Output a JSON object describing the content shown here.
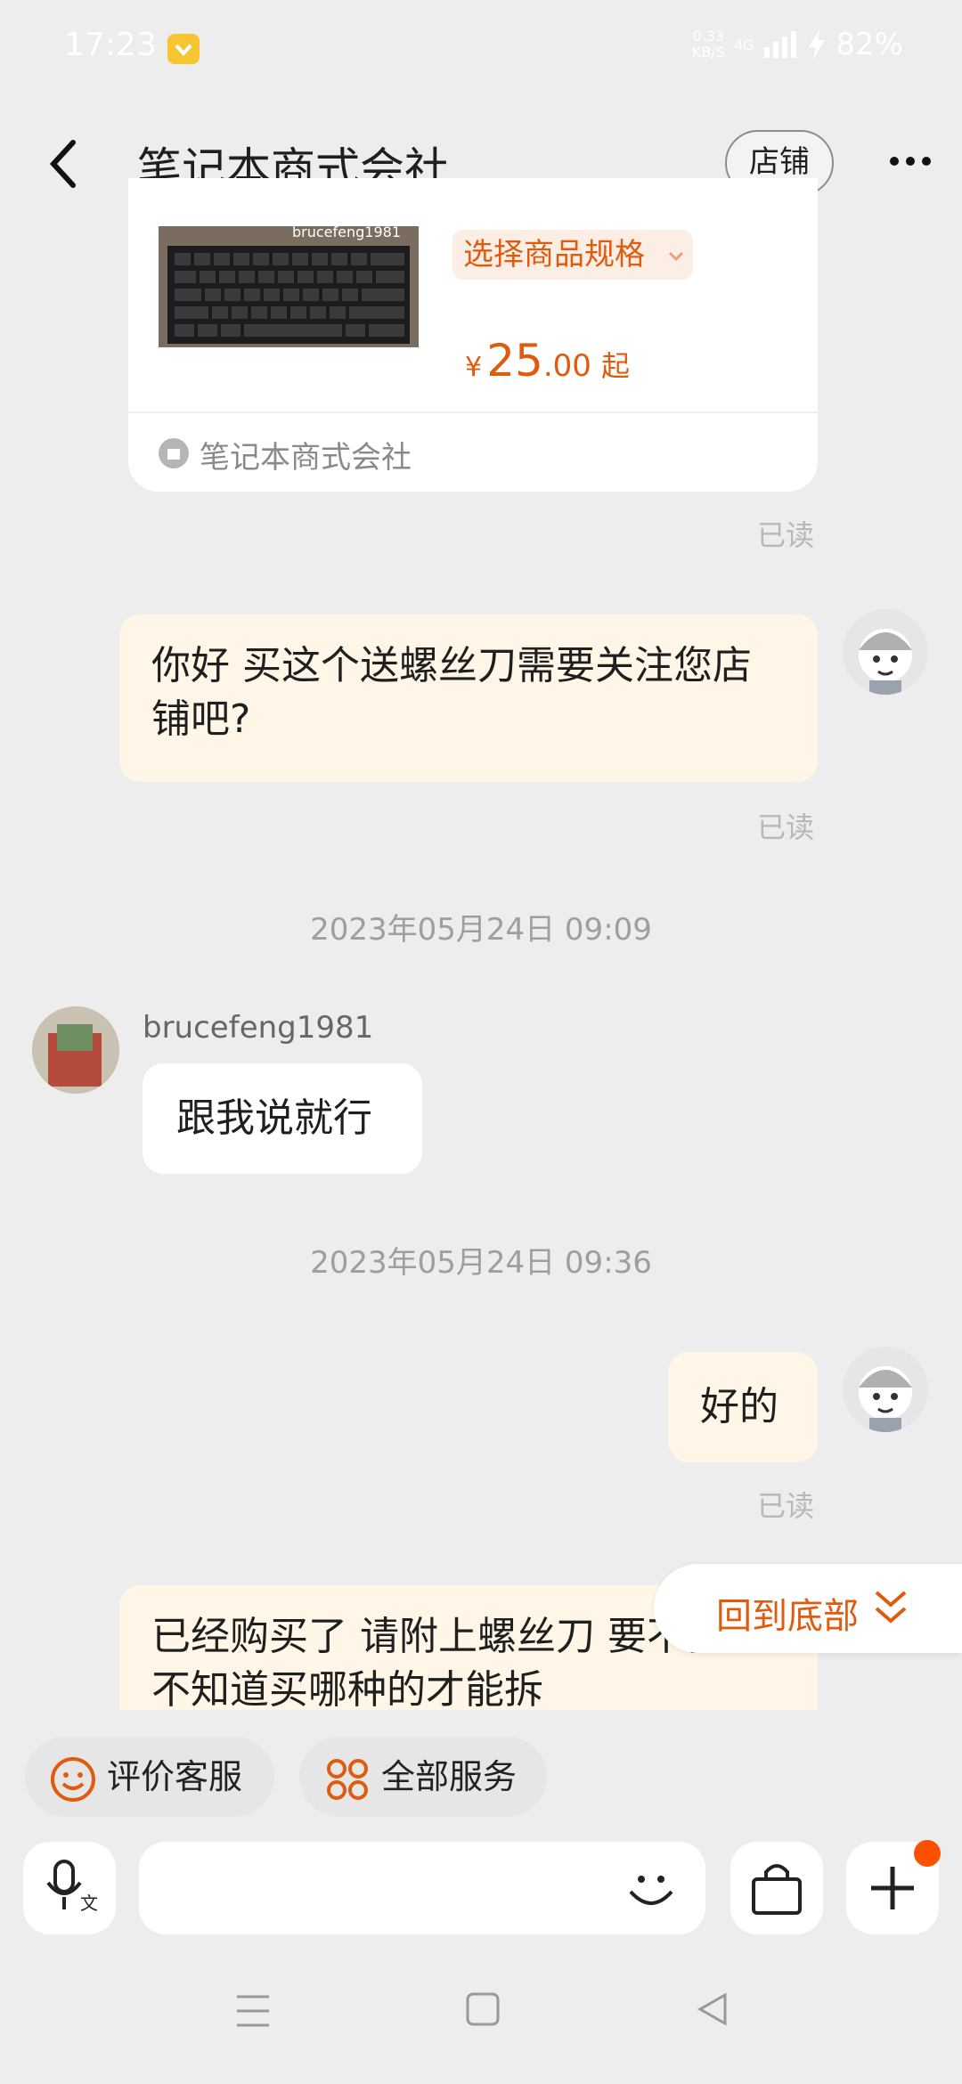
{
  "status_bar": {
    "time": "17:23",
    "speed_value": "0.33",
    "speed_unit": "KB/S",
    "network": "4G",
    "battery": "82%"
  },
  "header": {
    "title": "笔记本商式会社",
    "shop_button": "店铺"
  },
  "product_card": {
    "image_watermark": "brucefeng1981",
    "spec_button": "选择商品规格",
    "price_symbol": "¥",
    "price_int": "25",
    "price_dec": ".00",
    "price_suffix": "起",
    "shop_name": "笔记本商式会社"
  },
  "messages": {
    "read_label": "已读",
    "msg1": "你好  买这个送螺丝刀需要关注您店铺吧?",
    "time1": "2023年05月24日 09:09",
    "sender_name": "brucefeng1981",
    "msg2": "跟我说就行",
    "time2": "2023年05月24日 09:36",
    "msg3": "好的",
    "msg4": "已经购买了 请附上螺丝刀  要不我都不知道买哪种的才能拆"
  },
  "back_to_bottom": "回到底部",
  "quick_actions": {
    "rate_service": "评价客服",
    "all_services": "全部服务"
  },
  "colors": {
    "accent": "#e05b0d",
    "bubble_me": "#fff6e8",
    "badge": "#f7c531",
    "notification_dot": "#ff5000"
  }
}
